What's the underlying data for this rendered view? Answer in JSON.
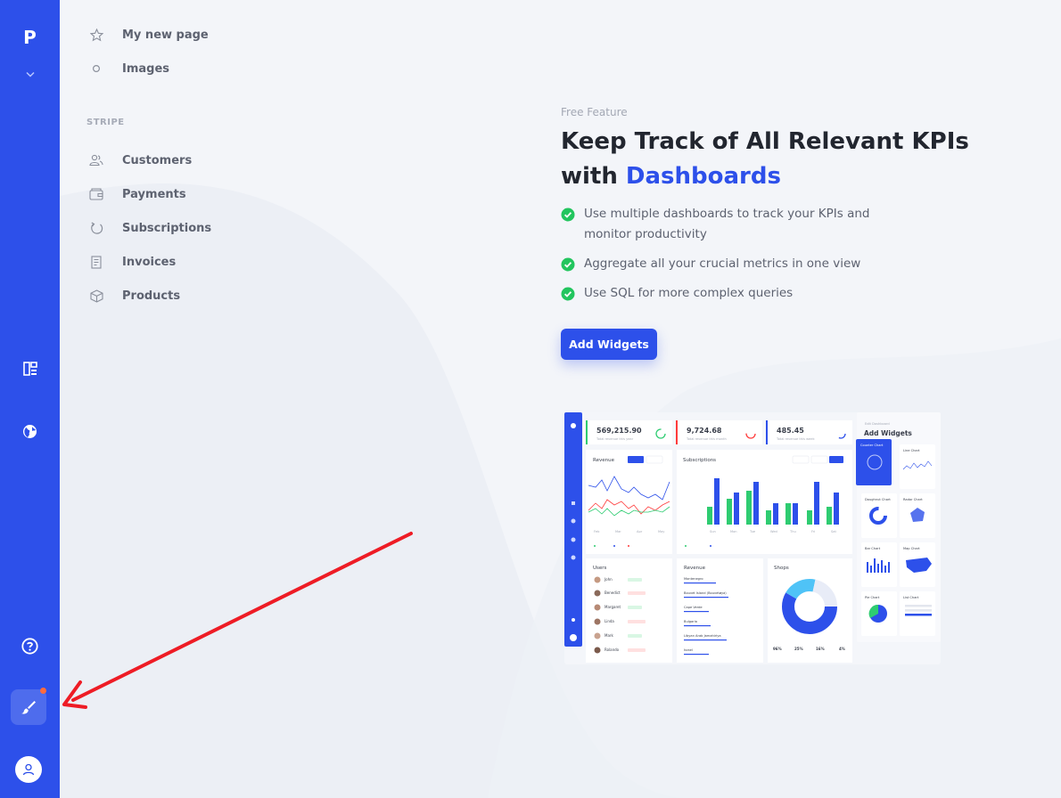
{
  "rail": {
    "logo": "P",
    "icons": [
      "chevron-down-icon",
      "dashboard-icon",
      "globe-icon",
      "help-icon",
      "brush-icon",
      "user-avatar-icon"
    ],
    "accent": "#2d50ea",
    "notification_dot": "#ff6b3d"
  },
  "nav": {
    "pages": [
      {
        "label": "My new page",
        "icon": "star-icon"
      },
      {
        "label": "Images",
        "icon": "circle-icon"
      }
    ],
    "section_label": "STRIPE",
    "stripe_items": [
      {
        "label": "Customers",
        "icon": "users-icon"
      },
      {
        "label": "Payments",
        "icon": "wallet-icon"
      },
      {
        "label": "Subscriptions",
        "icon": "refresh-icon"
      },
      {
        "label": "Invoices",
        "icon": "invoice-icon"
      },
      {
        "label": "Products",
        "icon": "box-icon"
      }
    ]
  },
  "hero": {
    "eyebrow": "Free Feature",
    "title_line1": "Keep Track of All Relevant KPIs",
    "title_prefix": "with ",
    "title_accent": "Dashboards",
    "features": [
      "Use multiple dashboards to track your KPIs and monitor productivity",
      "Aggregate all your crucial metrics in one view",
      "Use SQL for more complex queries"
    ],
    "cta_label": "Add Widgets"
  },
  "preview": {
    "kpis": [
      {
        "value": "569,215.90",
        "label": "Total revenue this year",
        "color": "#2ecc71"
      },
      {
        "value": "9,724.68",
        "label": "Total revenue this month",
        "color": "#ff3b3b"
      },
      {
        "value": "485.45",
        "label": "Total revenue this week",
        "color": "#2d50ea"
      }
    ],
    "panel_small": "Edit Dashboard",
    "panel_title": "Add Widgets",
    "revenue_title": "Revenue",
    "subscriptions_title": "Subscriptions",
    "users_title": "Users",
    "revenue_list_title": "Revenue",
    "shops_title": "Shops",
    "users": [
      "John",
      "Benedict",
      "Margaret",
      "Linda",
      "Mark",
      "Rolando"
    ],
    "countries": [
      "Montenegro",
      "Bouvet Island (Bouvetøya)",
      "Cape Verde",
      "Bulgaria",
      "Libyan Arab Jamahiriya",
      "Israel"
    ],
    "widgets": [
      "Counter Chart",
      "Line Chart",
      "Doughnut Chart",
      "Radar Chart",
      "Bar Chart",
      "Map Chart",
      "Pie Chart",
      "List Chart"
    ],
    "days": [
      "Sun",
      "Mon",
      "Tue",
      "Wed",
      "Thu",
      "Fri",
      "Sat"
    ],
    "months": [
      "Feb",
      "Mar",
      "Apr",
      "May"
    ],
    "shops_stats": [
      "96%",
      "25%",
      "16%",
      "4%"
    ]
  }
}
